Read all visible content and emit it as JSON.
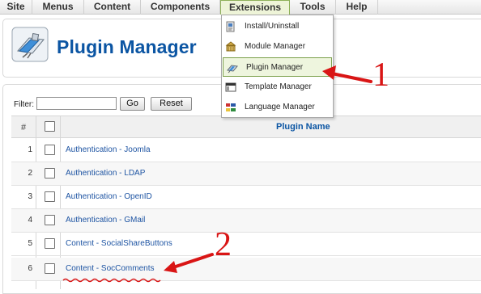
{
  "menubar": {
    "items": [
      {
        "label": "Site"
      },
      {
        "label": "Menus"
      },
      {
        "label": "Content"
      },
      {
        "label": "Components"
      },
      {
        "label": "Extensions",
        "active": true
      },
      {
        "label": "Tools"
      },
      {
        "label": "Help"
      }
    ]
  },
  "extensions_menu": {
    "items": [
      {
        "label": "Install/Uninstall",
        "icon": "install-icon"
      },
      {
        "label": "Module Manager",
        "icon": "module-icon"
      },
      {
        "label": "Plugin Manager",
        "icon": "plugin-icon",
        "highlighted": true
      },
      {
        "label": "Template Manager",
        "icon": "template-icon"
      },
      {
        "label": "Language Manager",
        "icon": "language-icon"
      }
    ]
  },
  "header": {
    "title": "Plugin Manager",
    "icon": "plugin-manager-icon"
  },
  "filter": {
    "label": "Filter:",
    "value": "",
    "go_label": "Go",
    "reset_label": "Reset"
  },
  "table": {
    "headers": {
      "number": "#",
      "name": "Plugin Name"
    },
    "rows": [
      {
        "number": "1",
        "name": "Authentication - Joomla"
      },
      {
        "number": "2",
        "name": "Authentication - LDAP"
      },
      {
        "number": "3",
        "name": "Authentication - OpenID"
      },
      {
        "number": "4",
        "name": "Authentication - GMail"
      },
      {
        "number": "5",
        "name": "Content - SocialShareButtons"
      },
      {
        "number": "6",
        "name": "Content - SocComments"
      }
    ]
  },
  "annotations": {
    "step1": "1",
    "step2": "2",
    "color": "#d91515"
  }
}
